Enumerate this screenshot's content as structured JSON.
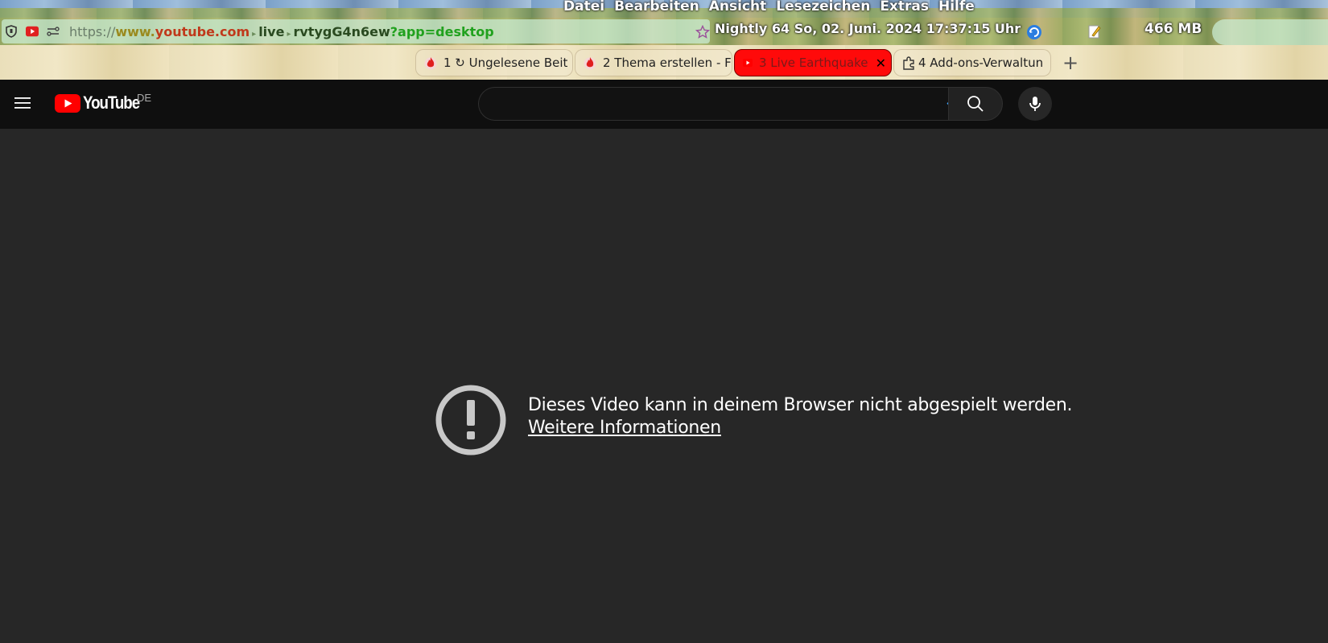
{
  "browser": {
    "menu": [
      "Datei",
      "Bearbeiten",
      "Ansicht",
      "Lesezeichen",
      "Extras",
      "Hilfe"
    ],
    "url": {
      "scheme": "https://",
      "www": "www.",
      "domain": "youtube.com",
      "path_1": "live",
      "path_2": "rvtygG4n6ew",
      "query": "?app=desktop"
    },
    "status_text": "Nightly 64 So, 02. Juni. 2024 17:37:15 Uhr",
    "memory": "466 MB",
    "tabs": [
      {
        "label": "1 ↻ Ungelesene Beit",
        "icon": "fire-icon"
      },
      {
        "label": "2 Thema erstellen - F",
        "icon": "fire-icon"
      },
      {
        "label": "3 Live Earthquake",
        "icon": "youtube-icon"
      },
      {
        "label": "4 Add-ons-Verwaltun",
        "icon": "puzzle-icon"
      }
    ],
    "new_tab": "+",
    "close_tab": "✕",
    "accent_active_tab": "#ff0a0a"
  },
  "youtube": {
    "logo_text": "YouTube",
    "region": "DE",
    "search": {
      "placeholder": "",
      "value": ""
    },
    "enter_glyph": "↵"
  },
  "error": {
    "message": "Dieses Video kann in deinem Browser nicht abgespielt werden.",
    "link": "Weitere Informationen"
  }
}
